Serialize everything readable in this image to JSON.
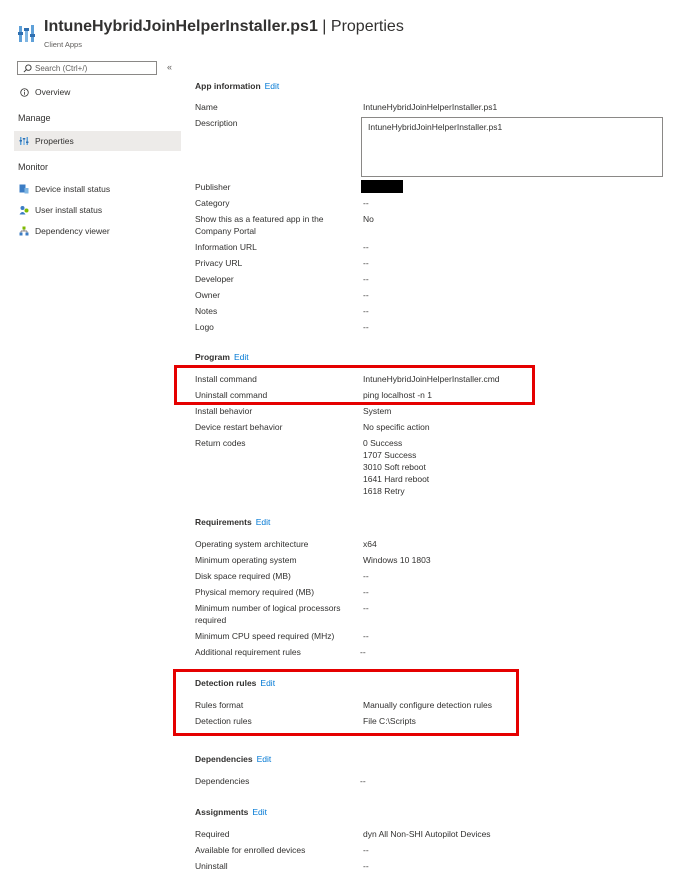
{
  "header": {
    "app_name": "IntuneHybridJoinHelperInstaller.ps1",
    "separator": "|",
    "page": "Properties",
    "subtitle": "Client Apps"
  },
  "sidebar": {
    "search_placeholder": "Search (Ctrl+/)",
    "collapse": "«",
    "overview": "Overview",
    "manage_title": "Manage",
    "properties": "Properties",
    "monitor_title": "Monitor",
    "monitor_items": [
      "Device install status",
      "User install status",
      "Dependency viewer"
    ]
  },
  "app_info": {
    "title": "App information",
    "edit": "Edit",
    "rows": [
      {
        "label": "Name",
        "value": "IntuneHybridJoinHelperInstaller.ps1"
      },
      {
        "label": "Description",
        "value": "IntuneHybridJoinHelperInstaller.ps1"
      },
      {
        "label": "Publisher",
        "value": ""
      },
      {
        "label": "Category",
        "value": "--"
      },
      {
        "label": "Show this as a featured app in the Company Portal",
        "value": "No"
      },
      {
        "label": "Information URL",
        "value": "--"
      },
      {
        "label": "Privacy URL",
        "value": "--"
      },
      {
        "label": "Developer",
        "value": "--"
      },
      {
        "label": "Owner",
        "value": "--"
      },
      {
        "label": "Notes",
        "value": "--"
      },
      {
        "label": "Logo",
        "value": "--"
      }
    ]
  },
  "program": {
    "title": "Program",
    "edit": "Edit",
    "rows": [
      {
        "label": "Install command",
        "value": "IntuneHybridJoinHelperInstaller.cmd"
      },
      {
        "label": "Uninstall command",
        "value": "ping localhost -n 1"
      },
      {
        "label": "Install behavior",
        "value": "System"
      },
      {
        "label": "Device restart behavior",
        "value": "No specific action"
      },
      {
        "label": "Return codes",
        "values": [
          "0 Success",
          "1707 Success",
          "3010 Soft reboot",
          "1641 Hard reboot",
          "1618 Retry"
        ]
      }
    ]
  },
  "requirements": {
    "title": "Requirements",
    "edit": "Edit",
    "rows": [
      {
        "label": "Operating system architecture",
        "value": "x64"
      },
      {
        "label": "Minimum operating system",
        "value": "Windows 10 1803"
      },
      {
        "label": "Disk space required (MB)",
        "value": "--"
      },
      {
        "label": "Physical memory required (MB)",
        "value": "--"
      },
      {
        "label": "Minimum number of logical processors required",
        "value": "--"
      },
      {
        "label": "Minimum CPU speed required (MHz)",
        "value": "--"
      },
      {
        "label": "Additional requirement rules",
        "value": "--"
      }
    ]
  },
  "detection": {
    "title": "Detection rules",
    "edit": "Edit",
    "rows": [
      {
        "label": "Rules format",
        "value": "Manually configure detection rules"
      },
      {
        "label": "Detection rules",
        "value": "File C:\\Scripts"
      }
    ]
  },
  "dependencies": {
    "title": "Dependencies",
    "edit": "Edit",
    "rows": [
      {
        "label": "Dependencies",
        "value": "--"
      }
    ]
  },
  "assignments": {
    "title": "Assignments",
    "edit": "Edit",
    "rows": [
      {
        "label": "Required",
        "value": "dyn All Non-SHI Autopilot Devices"
      },
      {
        "label": "Available for enrolled devices",
        "value": "--"
      },
      {
        "label": "Uninstall",
        "value": "--"
      }
    ]
  },
  "colors": {
    "accent": "#0078d4",
    "highlight": "#e50000",
    "text": "#323130",
    "active_nav": "#edebe9"
  }
}
